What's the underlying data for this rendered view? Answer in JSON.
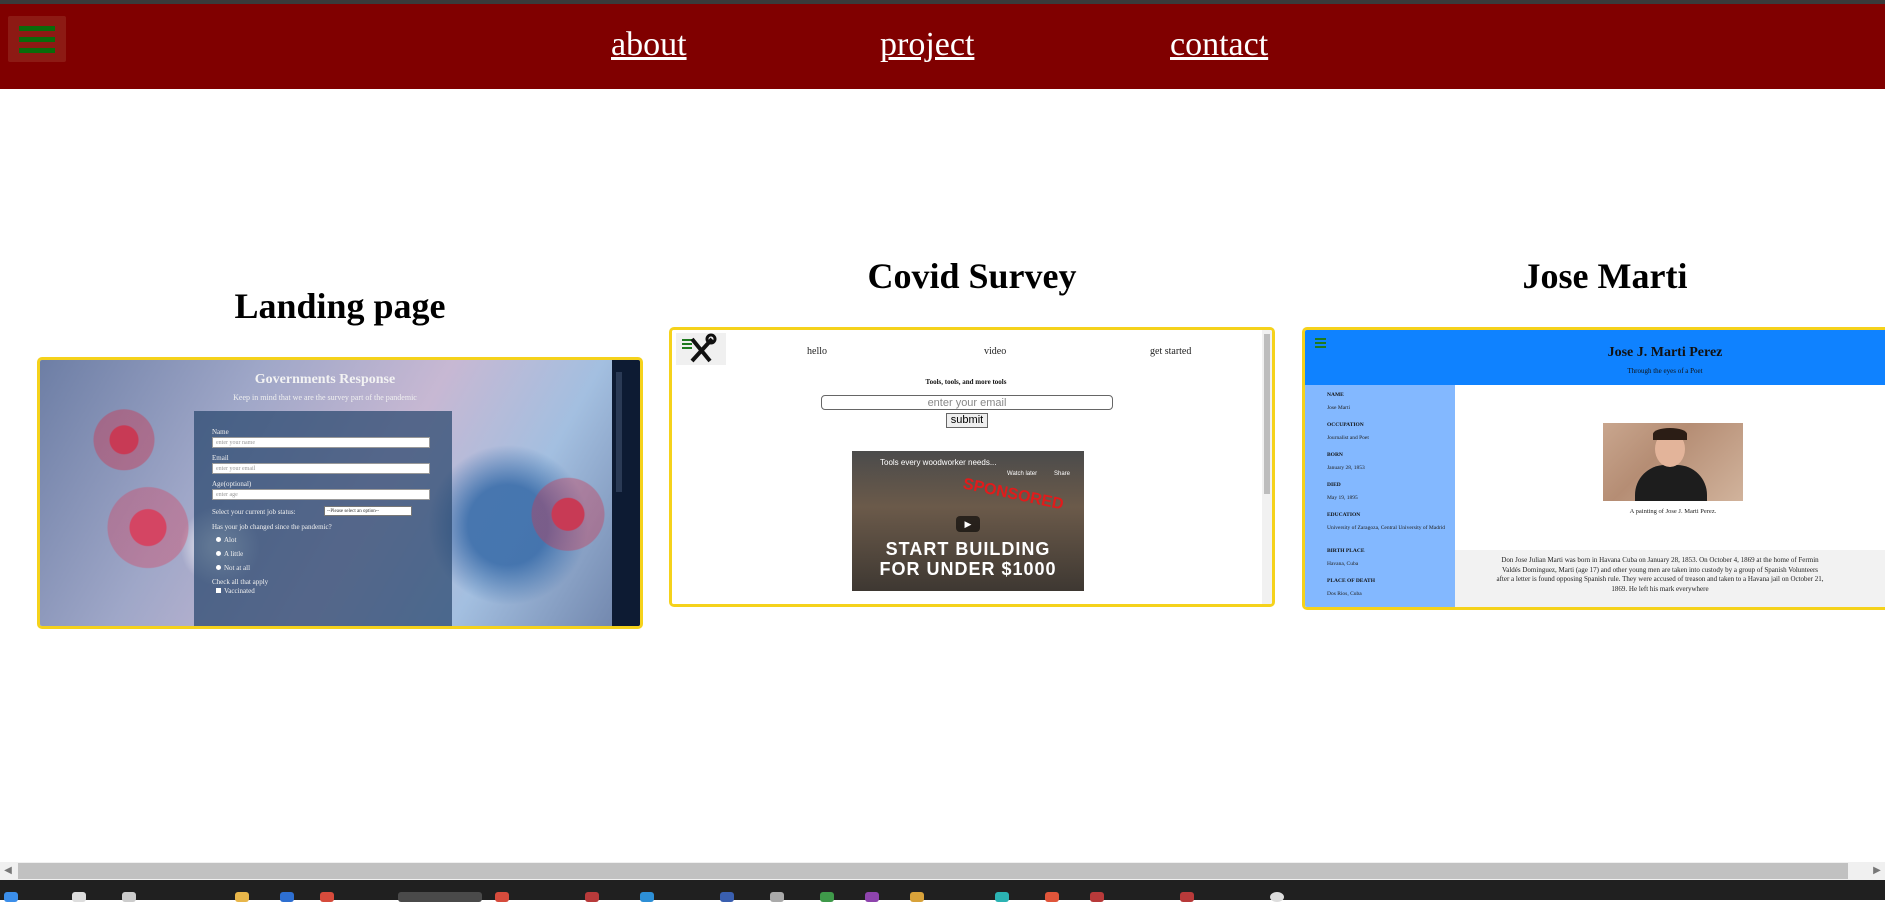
{
  "nav": {
    "links": [
      "about",
      "project",
      "contact"
    ]
  },
  "projects": [
    {
      "title": "Landing page",
      "preview": {
        "heading": "Governments Response",
        "subheading": "Keep in mind that we are the survey part of the pandemic",
        "fields": [
          {
            "label": "Name",
            "placeholder": "enter your name"
          },
          {
            "label": "Email",
            "placeholder": "enter your email"
          },
          {
            "label": "Age(optional)",
            "placeholder": "enter age"
          }
        ],
        "job_status_label": "Select your current job status:",
        "job_status_value": "--Please select an option--",
        "question": "Has your job changed since the pandemic?",
        "options": [
          "Alot",
          "A little",
          "Not at all"
        ],
        "check_label": "Check all that apply",
        "checks": [
          "Vaccinated"
        ]
      }
    },
    {
      "title": "Covid Survey",
      "preview": {
        "nav": [
          "hello",
          "video",
          "get started"
        ],
        "tagline": "Tools, tools, and more tools",
        "email_placeholder": "enter your email",
        "submit": "submit",
        "video": {
          "title": "Tools every woodworker needs...",
          "watch_later": "Watch later",
          "share": "Share",
          "sponsored": "SPONSORED",
          "line1": "START BUILDING",
          "line2": "FOR UNDER $1000"
        }
      }
    },
    {
      "title": "Jose Marti",
      "preview": {
        "heading": "Jose J. Marti Perez",
        "subheading": "Through the eyes of a Poet",
        "facts": [
          {
            "key": "NAME",
            "value": "Jose Marti"
          },
          {
            "key": "OCCUPATION",
            "value": "Journalist and Poet"
          },
          {
            "key": "BORN",
            "value": "January 28, 1853"
          },
          {
            "key": "DIED",
            "value": "May 19, 1895"
          },
          {
            "key": "EDUCATION",
            "value": "University of Zaragoza, Central University of Madrid"
          },
          {
            "key": "BIRTH PLACE",
            "value": "Havana, Cuba"
          },
          {
            "key": "PLACE OF DEATH",
            "value": "Dos Rios, Cuba"
          }
        ],
        "caption": "A painting of Jose J. Marti Perez.",
        "bio": "Don Jose Julian Marti was born in Havana Cuba on January 28, 1853. On October 4, 1869 at the home of Fermin Valdés Dominguez, Marti (age 17) and other young men are taken into custody by a group of Spanish Volunteers after a letter is found opposing Spanish rule. They were accused of treason and taken to a Havana jail on October 21, 1869. He left his mark everywhere"
      }
    }
  ],
  "colors": {
    "navbar": "#800000",
    "card_border": "#f5d21b",
    "jose_header": "#0f82ff",
    "jose_sidebar": "#83b8ff"
  }
}
